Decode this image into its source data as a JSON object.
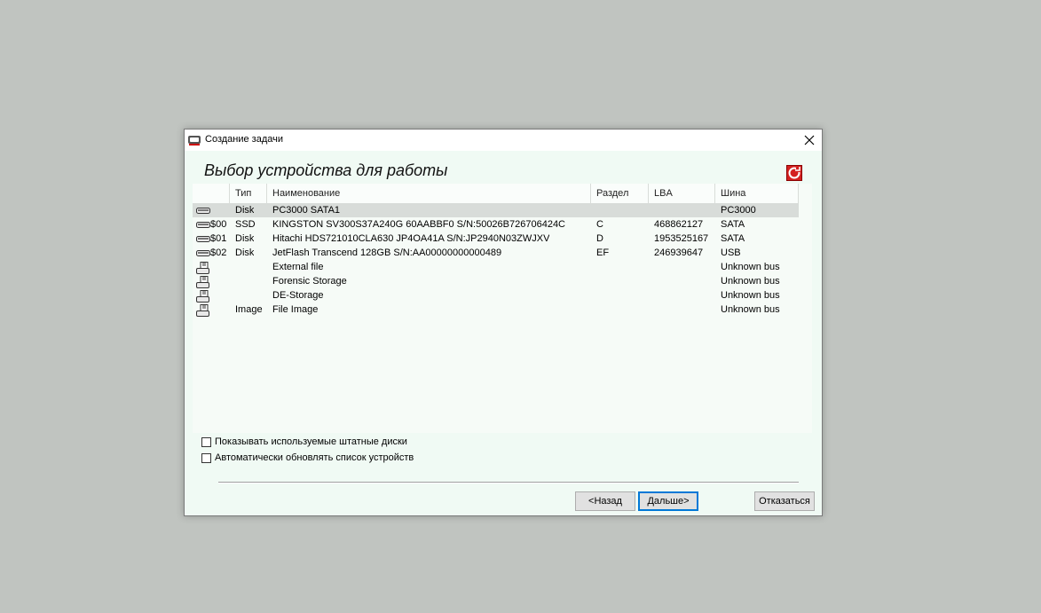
{
  "window": {
    "title": "Создание задачи"
  },
  "page": {
    "heading": "Выбор устройства для работы"
  },
  "table": {
    "columns": [
      "Тип",
      "Наименование",
      "Раздел",
      "LBA",
      "Шина"
    ],
    "rows": [
      {
        "id": "",
        "type": "Disk",
        "name": "PC3000 SATA1",
        "partition": "",
        "lba": "",
        "bus": "PC3000",
        "icon": "hdd-icon",
        "selected": true
      },
      {
        "id": "$00",
        "type": "SSD",
        "name": "KINGSTON SV300S37A240G 60AABBF0 S/N:50026B726706424C",
        "partition": "C",
        "lba": "468862127",
        "bus": "SATA",
        "icon": "hdd-icon",
        "selected": false
      },
      {
        "id": "$01",
        "type": "Disk",
        "name": "Hitachi HDS721010CLA630 JP4OA41A S/N:JP2940N03ZWJXV",
        "partition": "D",
        "lba": "1953525167",
        "bus": "SATA",
        "icon": "hdd-icon",
        "selected": false
      },
      {
        "id": "$02",
        "type": "Disk",
        "name": "JetFlash Transcend 128GB  S/N:AA00000000000489",
        "partition": "EF",
        "lba": "246939647",
        "bus": "USB",
        "icon": "hdd-icon",
        "selected": false
      },
      {
        "id": "",
        "type": "",
        "name": "External file",
        "partition": "",
        "lba": "",
        "bus": "Unknown bus",
        "icon": "file-drive-icon",
        "selected": false
      },
      {
        "id": "",
        "type": "",
        "name": "Forensic Storage",
        "partition": "",
        "lba": "",
        "bus": "Unknown bus",
        "icon": "file-drive-icon",
        "selected": false
      },
      {
        "id": "",
        "type": "",
        "name": "DE-Storage",
        "partition": "",
        "lba": "",
        "bus": "Unknown bus",
        "icon": "file-drive-icon",
        "selected": false
      },
      {
        "id": "",
        "type": "Image",
        "name": "File Image",
        "partition": "",
        "lba": "",
        "bus": "Unknown bus",
        "icon": "file-drive-icon",
        "selected": false
      }
    ]
  },
  "options": {
    "show_used_disks": {
      "label": "Показывать используемые штатные диски",
      "checked": false
    },
    "auto_refresh": {
      "label": "Автоматически обновлять список устройств",
      "checked": false
    }
  },
  "buttons": {
    "back": "<Назад",
    "next": "Дальше>",
    "cancel": "Отказаться"
  }
}
